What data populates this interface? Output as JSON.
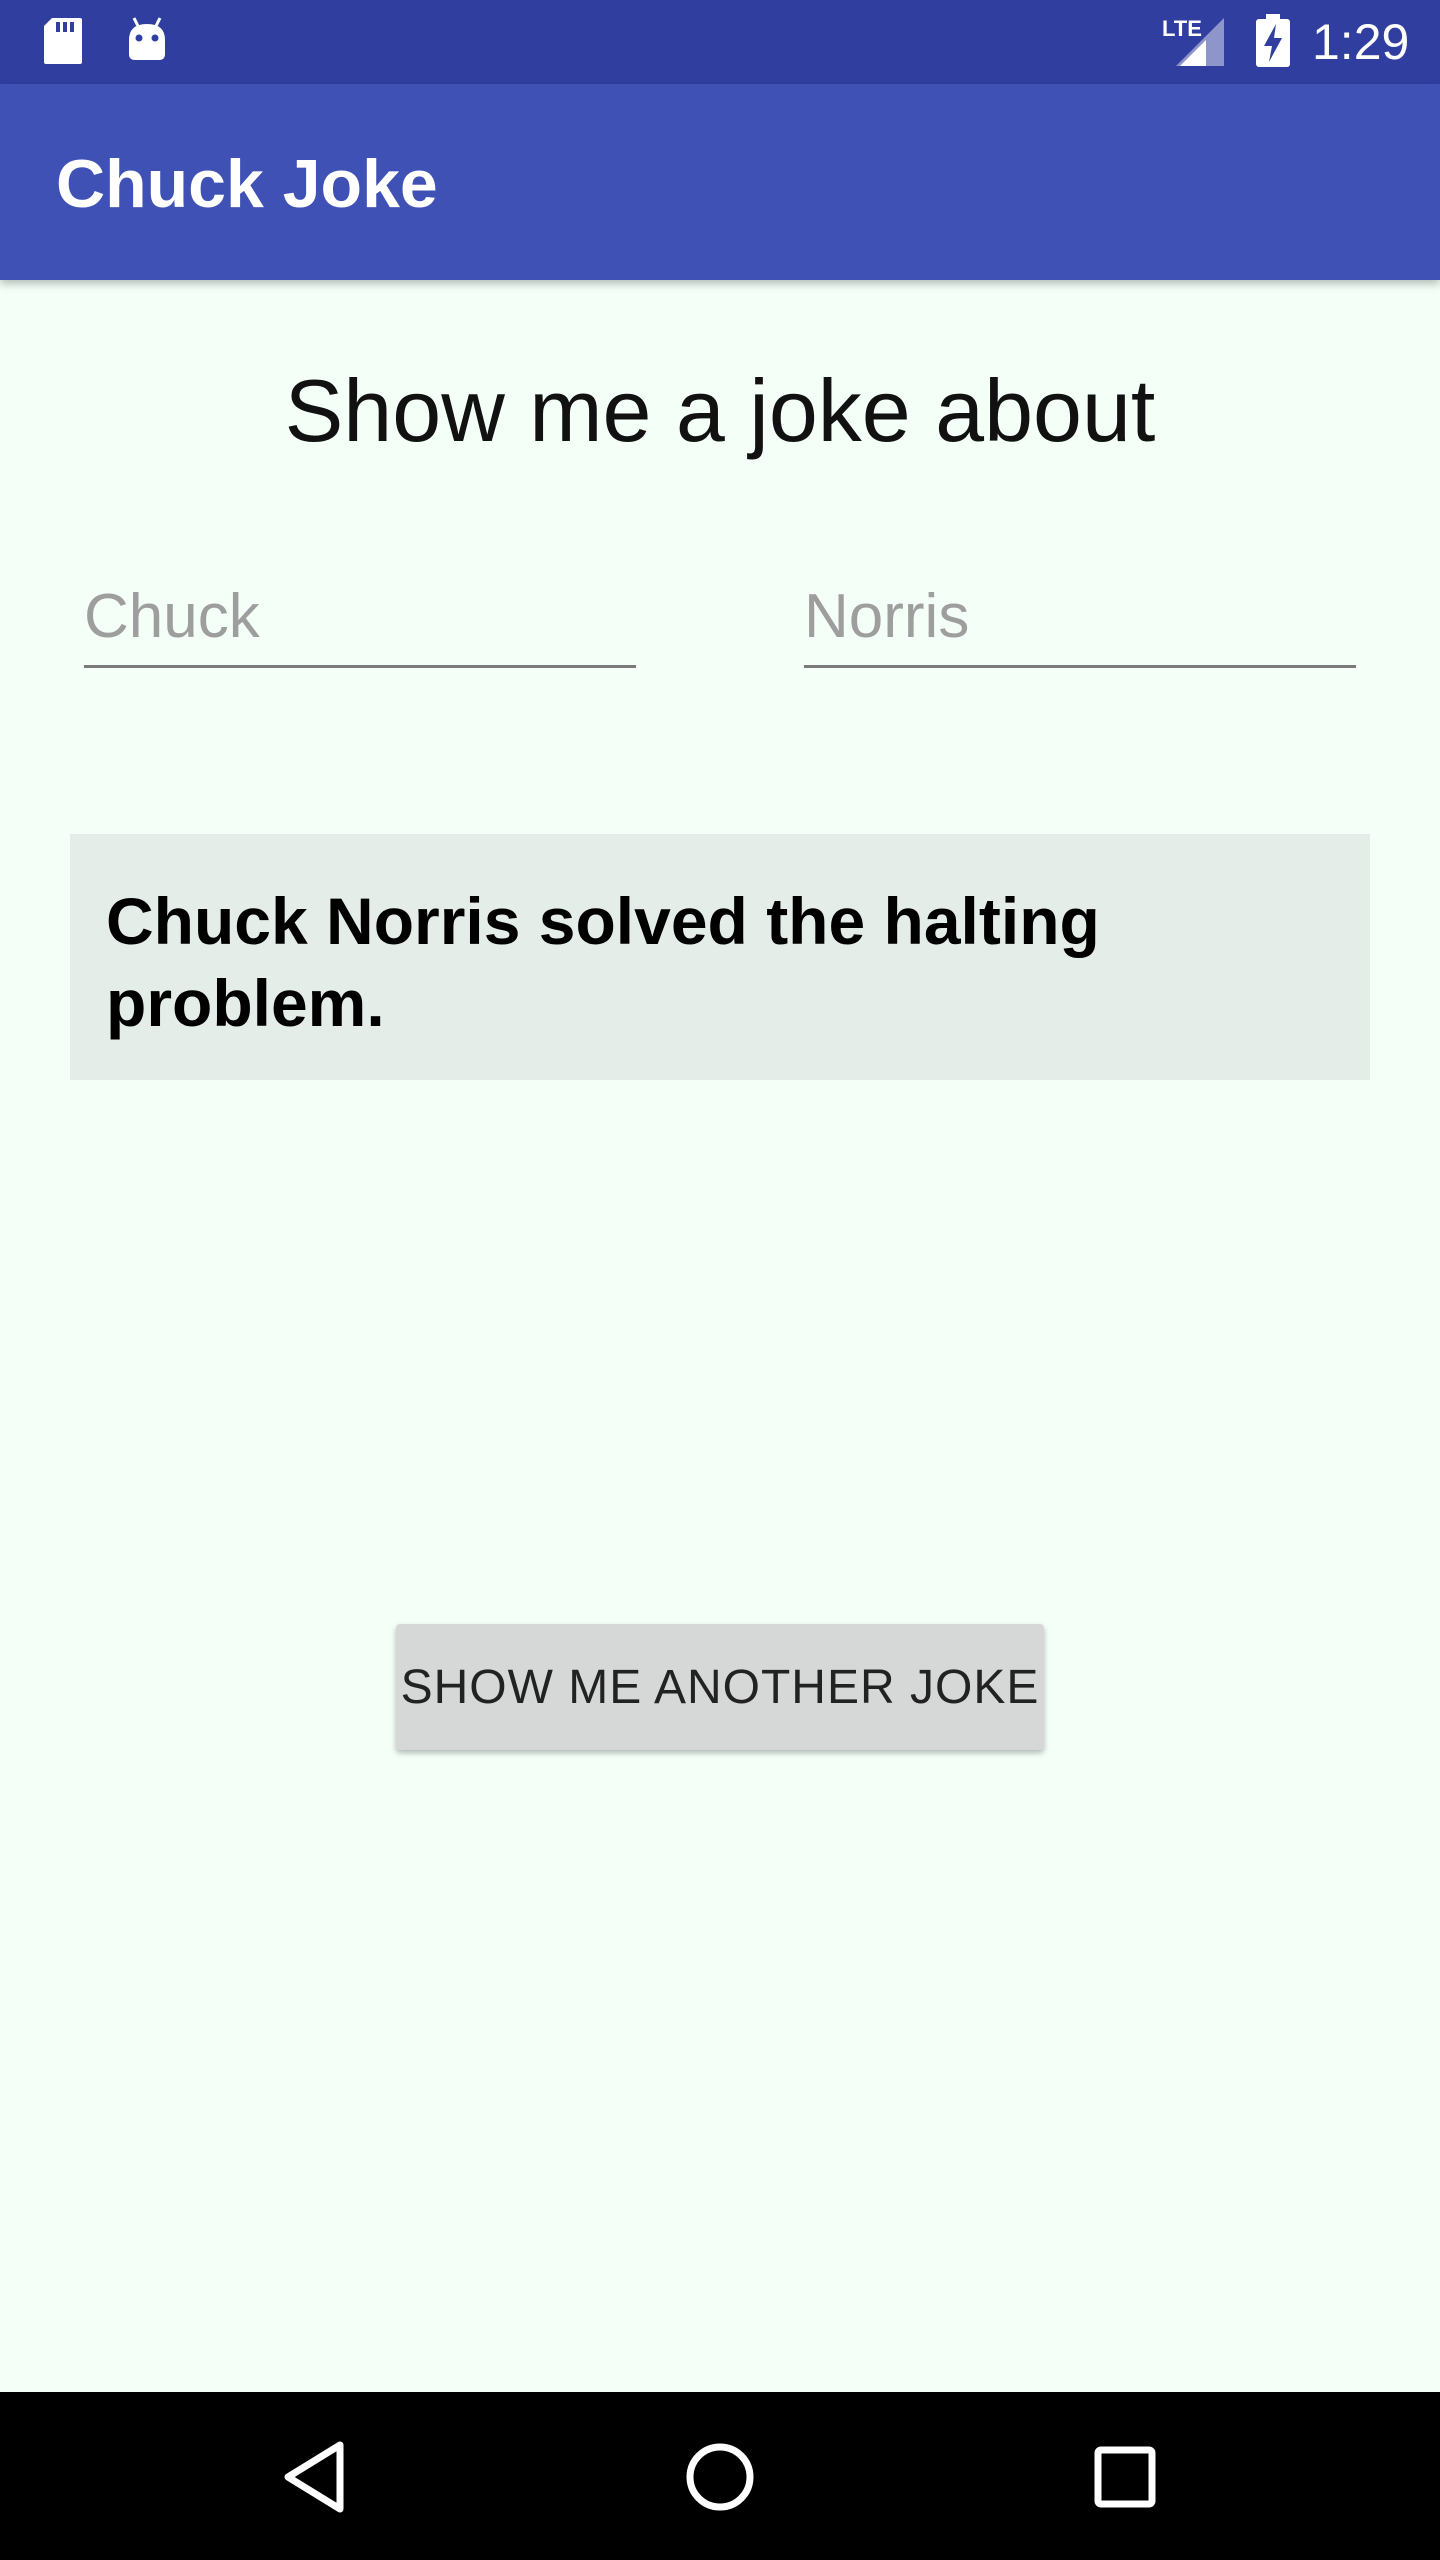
{
  "status_bar": {
    "time": "1:29",
    "network_label": "LTE",
    "icons": [
      "sd-card-icon",
      "android-debug-icon",
      "lte-signal-icon",
      "battery-charging-icon"
    ]
  },
  "app_bar": {
    "title": "Chuck Joke"
  },
  "main": {
    "heading": "Show me a joke about",
    "first_name": {
      "value": "",
      "placeholder": "Chuck"
    },
    "last_name": {
      "value": "",
      "placeholder": "Norris"
    },
    "joke": "Chuck Norris solved the halting problem.",
    "another_joke_button": "SHOW ME ANOTHER JOKE"
  },
  "nav_bar": {
    "icons": [
      "back-icon",
      "home-icon",
      "recents-icon"
    ]
  },
  "colors": {
    "status_bar": "#303f9f",
    "app_bar": "#3f51b5",
    "background": "#f4fff8",
    "joke_card": "#e4ede8",
    "button": "#d6d7d7"
  }
}
